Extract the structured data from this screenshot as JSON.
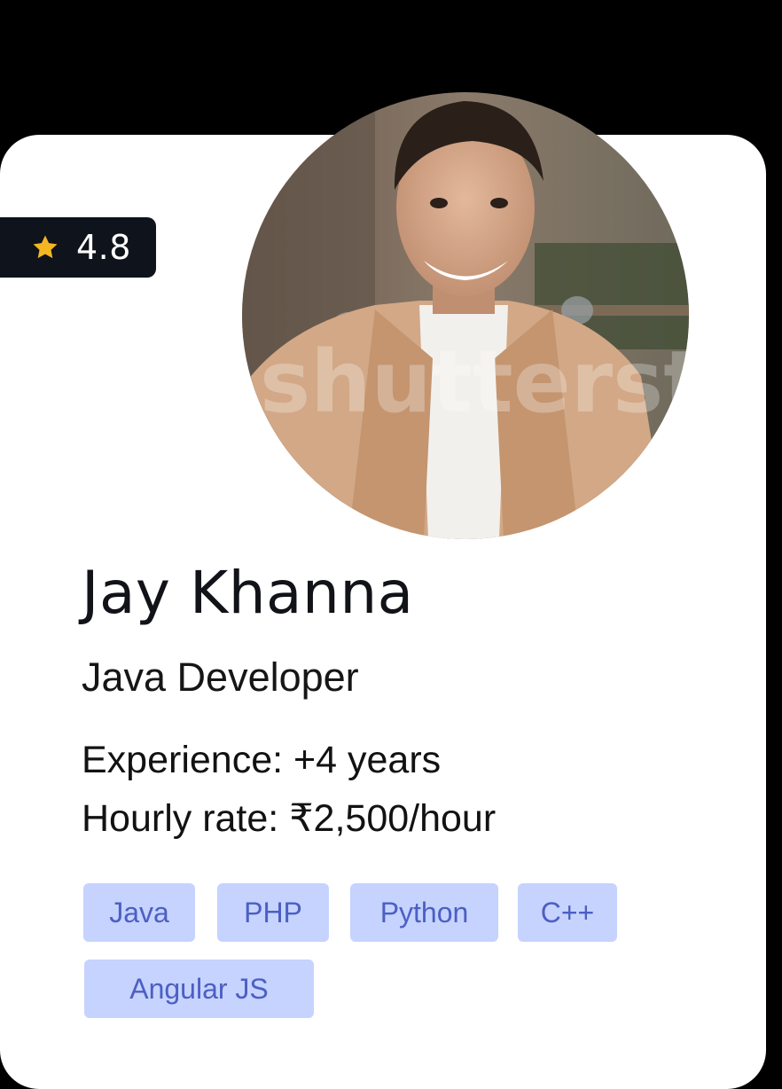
{
  "profile": {
    "name": "Jay Khanna",
    "role": "Java Developer",
    "experience": "Experience: +4 years",
    "hourly_rate": "Hourly rate: ₹2,500/hour",
    "rating": "4.8",
    "photo_watermark": "shutterst"
  },
  "skills": [
    "Java",
    "PHP",
    "Python",
    "C++",
    "Angular JS"
  ],
  "colors": {
    "background": "#000000",
    "card": "#ffffff",
    "badge": "#0f131b",
    "star": "#f5b623",
    "tag_bg": "#c6d3ff",
    "tag_text": "#4c5fc2"
  },
  "icons": {
    "rating": "star-icon"
  }
}
